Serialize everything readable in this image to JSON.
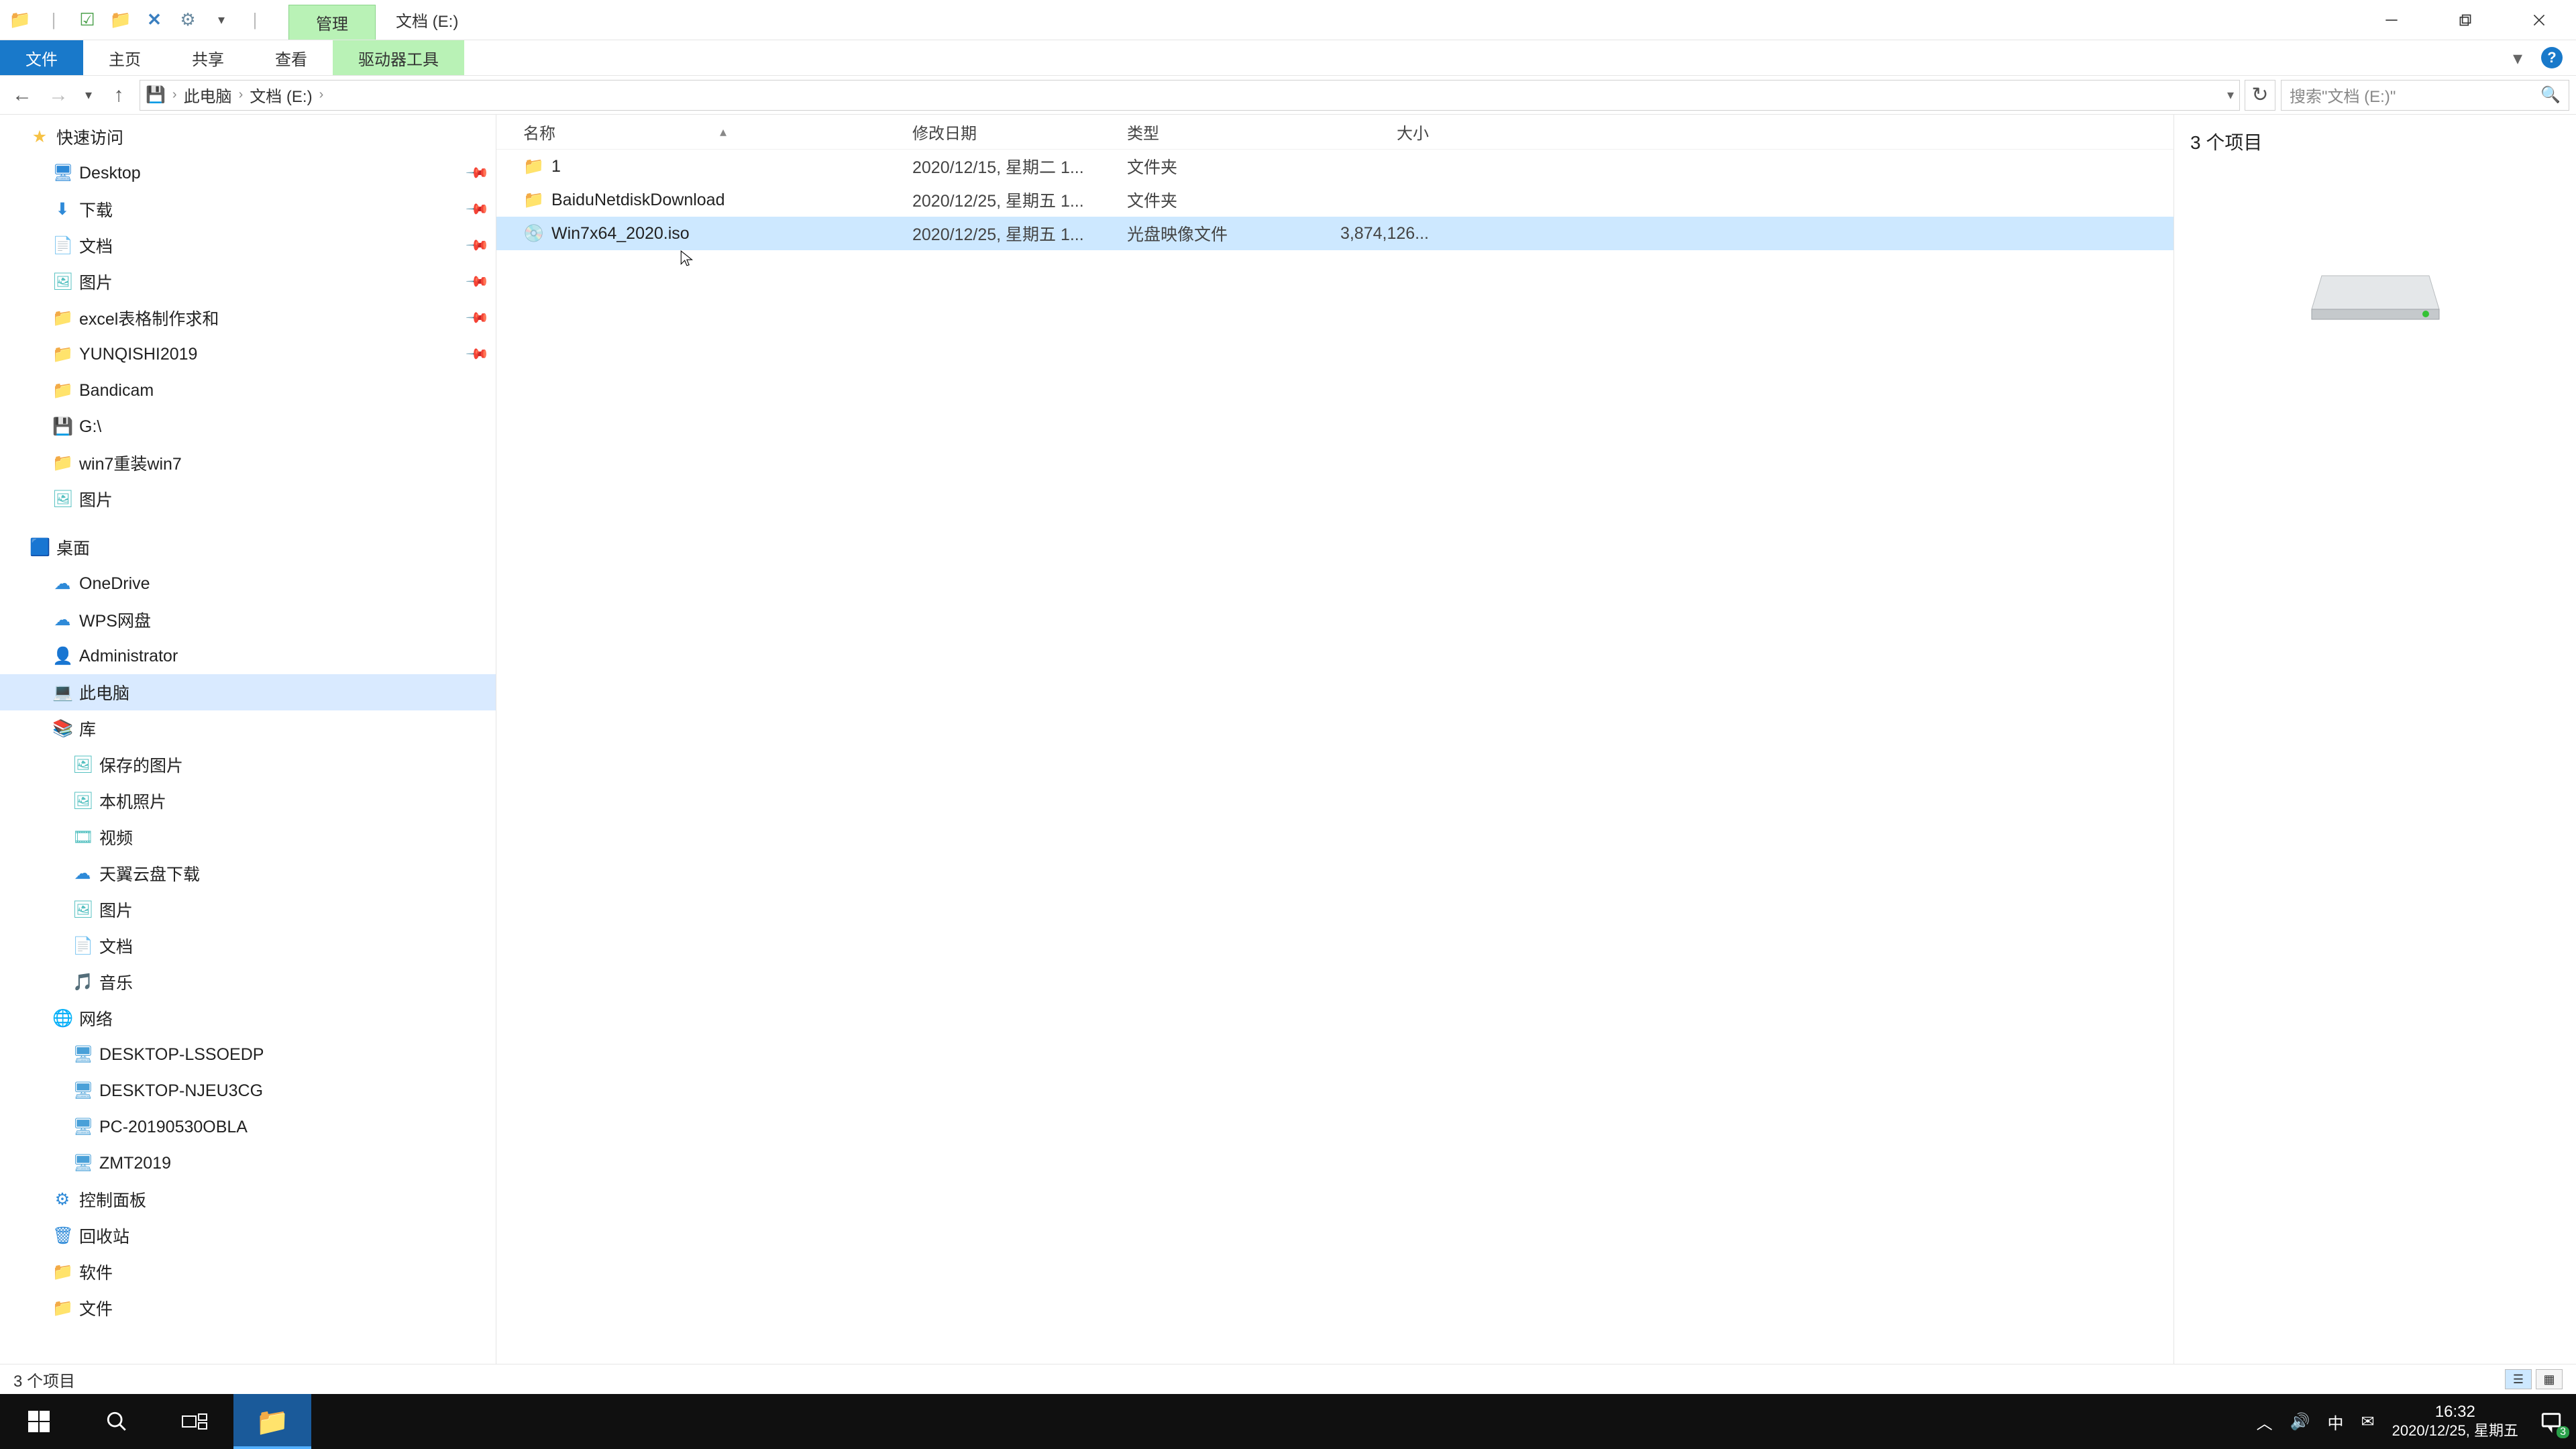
{
  "window": {
    "context_tab": "管理",
    "caption": "文档 (E:)",
    "minimize_hint": "Minimize",
    "maximize_hint": "Restore",
    "close_hint": "Close",
    "quick_access_toolbar": {
      "tip": "自定义快速访问工具栏"
    }
  },
  "ribbon": {
    "file": "文件",
    "tabs": [
      "主页",
      "共享",
      "查看"
    ],
    "context_tab": "驱动器工具",
    "expand": "▾",
    "help": "?"
  },
  "nav": {
    "back": "←",
    "forward": "→",
    "recent": "▾",
    "up": "↑",
    "breadcrumb": [
      "此电脑",
      "文档 (E:)"
    ],
    "separator": "›",
    "refresh": "↻",
    "search_placeholder": "搜索\"文档 (E:)\"",
    "breadcrumb_dropdown": "▾"
  },
  "sidebar": [
    {
      "indent": 44,
      "icon_class": "i-star",
      "icon": "★",
      "label": "快速访问",
      "pinned": false
    },
    {
      "indent": 78,
      "icon_class": "i-desktop",
      "icon": "🖥",
      "label": "Desktop",
      "pinned": true
    },
    {
      "indent": 78,
      "icon_class": "i-dl",
      "icon": "⬇",
      "label": "下载",
      "pinned": true
    },
    {
      "indent": 78,
      "icon_class": "i-doc",
      "icon": "📄",
      "label": "文档",
      "pinned": true
    },
    {
      "indent": 78,
      "icon_class": "i-pic",
      "icon": "🖼",
      "label": "图片",
      "pinned": true
    },
    {
      "indent": 78,
      "icon_class": "i-folder",
      "icon": "📁",
      "label": "excel表格制作求和",
      "pinned": true
    },
    {
      "indent": 78,
      "icon_class": "i-folder",
      "icon": "📁",
      "label": "YUNQISHI2019",
      "pinned": true
    },
    {
      "indent": 78,
      "icon_class": "i-folder",
      "icon": "📁",
      "label": "Bandicam",
      "pinned": false
    },
    {
      "indent": 78,
      "icon_class": "i-folder",
      "icon": "💾",
      "label": "G:\\",
      "pinned": false
    },
    {
      "indent": 78,
      "icon_class": "i-folder",
      "icon": "📁",
      "label": "win7重装win7",
      "pinned": false
    },
    {
      "indent": 78,
      "icon_class": "i-pic",
      "icon": "🖼",
      "label": "图片",
      "pinned": false
    },
    {
      "indent": 44,
      "spacer": true
    },
    {
      "indent": 44,
      "icon_class": "i-desktop",
      "icon": "🟦",
      "label": "桌面",
      "pinned": false
    },
    {
      "indent": 78,
      "icon_class": "i-cloud",
      "icon": "☁",
      "label": "OneDrive",
      "pinned": false
    },
    {
      "indent": 78,
      "icon_class": "i-cloud",
      "icon": "☁",
      "label": "WPS网盘",
      "pinned": false
    },
    {
      "indent": 78,
      "icon_class": "i-user",
      "icon": "👤",
      "label": "Administrator",
      "pinned": false
    },
    {
      "indent": 78,
      "icon_class": "i-pc",
      "icon": "💻",
      "label": "此电脑",
      "pinned": false,
      "selected": true
    },
    {
      "indent": 78,
      "icon_class": "i-lib",
      "icon": "📚",
      "label": "库",
      "pinned": false
    },
    {
      "indent": 108,
      "icon_class": "i-pic",
      "icon": "🖼",
      "label": "保存的图片",
      "pinned": false
    },
    {
      "indent": 108,
      "icon_class": "i-pic",
      "icon": "🖼",
      "label": "本机照片",
      "pinned": false
    },
    {
      "indent": 108,
      "icon_class": "i-pic",
      "icon": "🎞",
      "label": "视频",
      "pinned": false
    },
    {
      "indent": 108,
      "icon_class": "i-cloud",
      "icon": "☁",
      "label": "天翼云盘下载",
      "pinned": false
    },
    {
      "indent": 108,
      "icon_class": "i-pic",
      "icon": "🖼",
      "label": "图片",
      "pinned": false
    },
    {
      "indent": 108,
      "icon_class": "i-doc",
      "icon": "📄",
      "label": "文档",
      "pinned": false
    },
    {
      "indent": 108,
      "icon_class": "i-doc",
      "icon": "🎵",
      "label": "音乐",
      "pinned": false
    },
    {
      "indent": 78,
      "icon_class": "i-net",
      "icon": "🌐",
      "label": "网络",
      "pinned": false
    },
    {
      "indent": 108,
      "icon_class": "i-comp",
      "icon": "🖥",
      "label": "DESKTOP-LSSOEDP",
      "pinned": false
    },
    {
      "indent": 108,
      "icon_class": "i-comp",
      "icon": "🖥",
      "label": "DESKTOP-NJEU3CG",
      "pinned": false
    },
    {
      "indent": 108,
      "icon_class": "i-comp",
      "icon": "🖥",
      "label": "PC-20190530OBLA",
      "pinned": false
    },
    {
      "indent": 108,
      "icon_class": "i-comp",
      "icon": "🖥",
      "label": "ZMT2019",
      "pinned": false
    },
    {
      "indent": 78,
      "icon_class": "i-cpanel",
      "icon": "⚙",
      "label": "控制面板",
      "pinned": false
    },
    {
      "indent": 78,
      "icon_class": "i-recycle",
      "icon": "🗑",
      "label": "回收站",
      "pinned": false
    },
    {
      "indent": 78,
      "icon_class": "i-folder",
      "icon": "📁",
      "label": "软件",
      "pinned": false
    },
    {
      "indent": 78,
      "icon_class": "i-folder",
      "icon": "📁",
      "label": "文件",
      "pinned": false
    }
  ],
  "columns": {
    "name": "名称",
    "date": "修改日期",
    "type": "类型",
    "size": "大小",
    "sort": "▴"
  },
  "files": [
    {
      "icon": "📁",
      "icon_class": "i-folder",
      "name": "1",
      "date": "2020/12/15, 星期二 1...",
      "type": "文件夹",
      "size": ""
    },
    {
      "icon": "📁",
      "icon_class": "i-folder",
      "name": "BaiduNetdiskDownload",
      "date": "2020/12/25, 星期五 1...",
      "type": "文件夹",
      "size": ""
    },
    {
      "icon": "💿",
      "icon_class": "i-iso",
      "name": "Win7x64_2020.iso",
      "date": "2020/12/25, 星期五 1...",
      "type": "光盘映像文件",
      "size": "3,874,126...",
      "selected": true
    }
  ],
  "preview": {
    "title": "3 个项目"
  },
  "status": {
    "text": "3 个项目"
  },
  "taskbar": {
    "start_hint": "Start",
    "search_hint": "Search",
    "taskview_hint": "Task view",
    "explorer_hint": "File Explorer",
    "tray": {
      "up": "︿",
      "vol": "🔊",
      "ime": "中",
      "mail": "✉",
      "time": "16:32",
      "date": "2020/12/25, 星期五",
      "notif_count": "3"
    }
  }
}
